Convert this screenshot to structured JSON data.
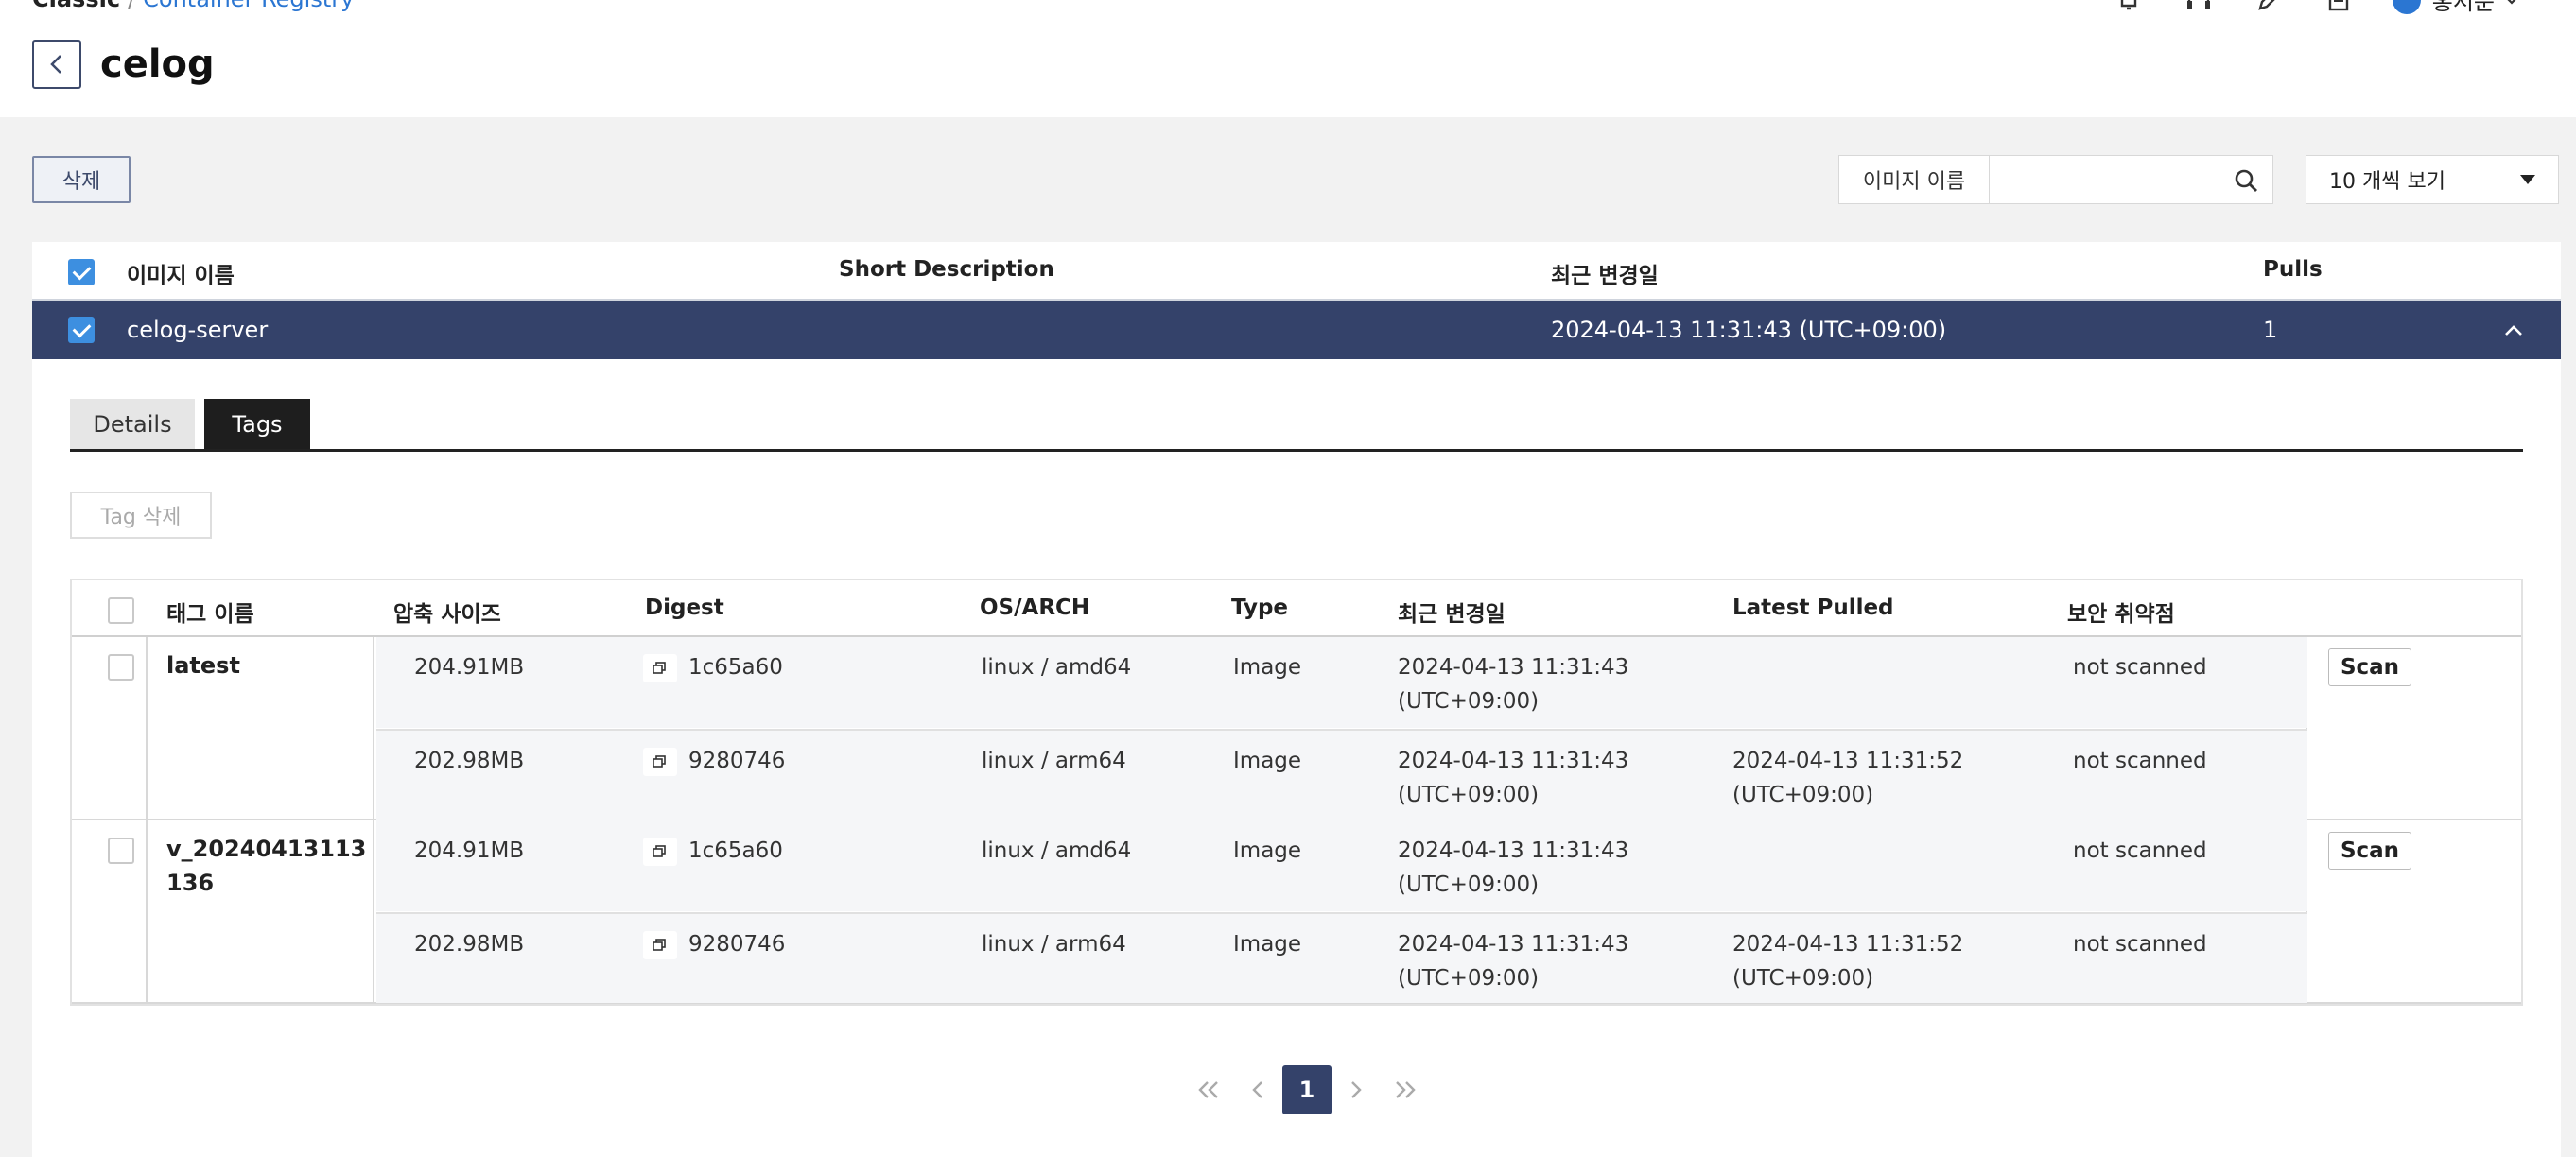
{
  "header": {
    "breadcrumb_root": "Classic",
    "breadcrumb_sep": "/",
    "breadcrumb_link": "Container Registry",
    "title": "celog",
    "user_name": "홍서준"
  },
  "toolbar": {
    "delete_label": "삭제",
    "search_label": "이미지 이름",
    "search_value": "",
    "page_size": "10 개씩 보기"
  },
  "images_table": {
    "columns": [
      "이미지 이름",
      "Short Description",
      "최근 변경일",
      "Pulls"
    ],
    "selected_row": {
      "name": "celog-server",
      "description": "",
      "updated": "2024-04-13 11:31:43 (UTC+09:00)",
      "pulls": "1"
    }
  },
  "tabs": [
    "Details",
    "Tags"
  ],
  "tag_delete_label": "Tag 삭제",
  "tags_table": {
    "columns": [
      "태그 이름",
      "압축 사이즈",
      "Digest",
      "OS/ARCH",
      "Type",
      "최근 변경일",
      "Latest Pulled",
      "보안 취약점"
    ],
    "scan_label": "Scan",
    "groups": [
      {
        "name": "latest",
        "rows": [
          {
            "size": "204.91MB",
            "digest": "1c65a60",
            "os_arch": "linux / amd64",
            "type": "Image",
            "updated_1": "2024-04-13 11:31:43",
            "updated_2": "(UTC+09:00)",
            "pulled_1": "",
            "pulled_2": "",
            "security": "not scanned"
          },
          {
            "size": "202.98MB",
            "digest": "9280746",
            "os_arch": "linux / arm64",
            "type": "Image",
            "updated_1": "2024-04-13 11:31:43",
            "updated_2": "(UTC+09:00)",
            "pulled_1": "2024-04-13 11:31:52",
            "pulled_2": "(UTC+09:00)",
            "security": "not scanned"
          }
        ]
      },
      {
        "name": "v_20240413113136",
        "rows": [
          {
            "size": "204.91MB",
            "digest": "1c65a60",
            "os_arch": "linux / amd64",
            "type": "Image",
            "updated_1": "2024-04-13 11:31:43",
            "updated_2": "(UTC+09:00)",
            "pulled_1": "",
            "pulled_2": "",
            "security": "not scanned"
          },
          {
            "size": "202.98MB",
            "digest": "9280746",
            "os_arch": "linux / arm64",
            "type": "Image",
            "updated_1": "2024-04-13 11:31:43",
            "updated_2": "(UTC+09:00)",
            "pulled_1": "2024-04-13 11:31:52",
            "pulled_2": "(UTC+09:00)",
            "security": "not scanned"
          }
        ]
      }
    ]
  },
  "pagination": {
    "current_page": "1",
    "first_icon": "double-chevron-left-icon",
    "prev_icon": "chevron-left-icon",
    "next_icon": "chevron-right-icon",
    "last_icon": "double-chevron-right-icon"
  },
  "colors": {
    "selected_row": "#34426a",
    "checkbox": "#3d8fe0",
    "link": "#2b76d2"
  }
}
